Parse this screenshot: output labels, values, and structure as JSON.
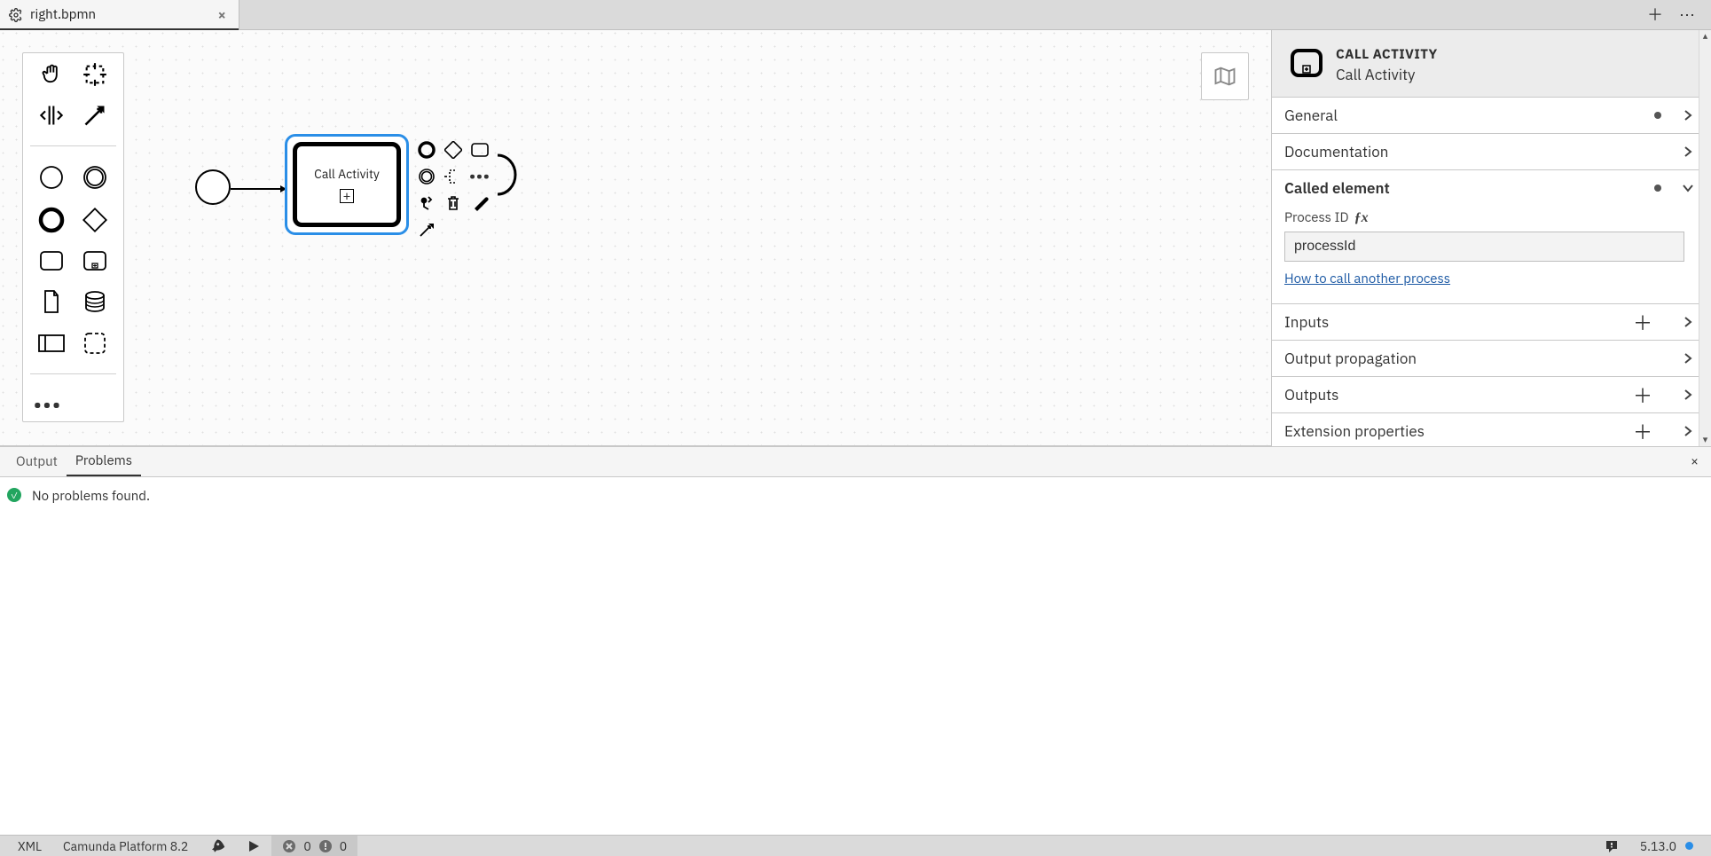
{
  "tab": {
    "filename": "right.bpmn"
  },
  "palette": {
    "tools": [
      "hand-tool",
      "lasso-tool",
      "space-tool",
      "connect-tool",
      "start-event",
      "intermediate-event",
      "end-event",
      "gateway",
      "task",
      "subprocess",
      "data-object",
      "data-store",
      "participant",
      "group"
    ]
  },
  "diagram": {
    "call_activity_label": "Call Activity"
  },
  "properties": {
    "type_label": "CALL ACTIVITY",
    "name": "Call Activity",
    "groups": {
      "general": {
        "title": "General"
      },
      "documentation": {
        "title": "Documentation"
      },
      "called_element": {
        "title": "Called element",
        "process_id_label": "Process ID",
        "process_id_value": "processId",
        "help_link": "How to call another process"
      },
      "inputs": {
        "title": "Inputs"
      },
      "output_propagation": {
        "title": "Output propagation"
      },
      "outputs": {
        "title": "Outputs"
      },
      "extension_properties": {
        "title": "Extension properties"
      }
    }
  },
  "bottom": {
    "tabs": {
      "output": "Output",
      "problems": "Problems"
    },
    "message": "No problems found."
  },
  "status": {
    "xml": "XML",
    "platform": "Camunda Platform 8.2",
    "errors": "0",
    "warnings": "0",
    "version": "5.13.0"
  }
}
